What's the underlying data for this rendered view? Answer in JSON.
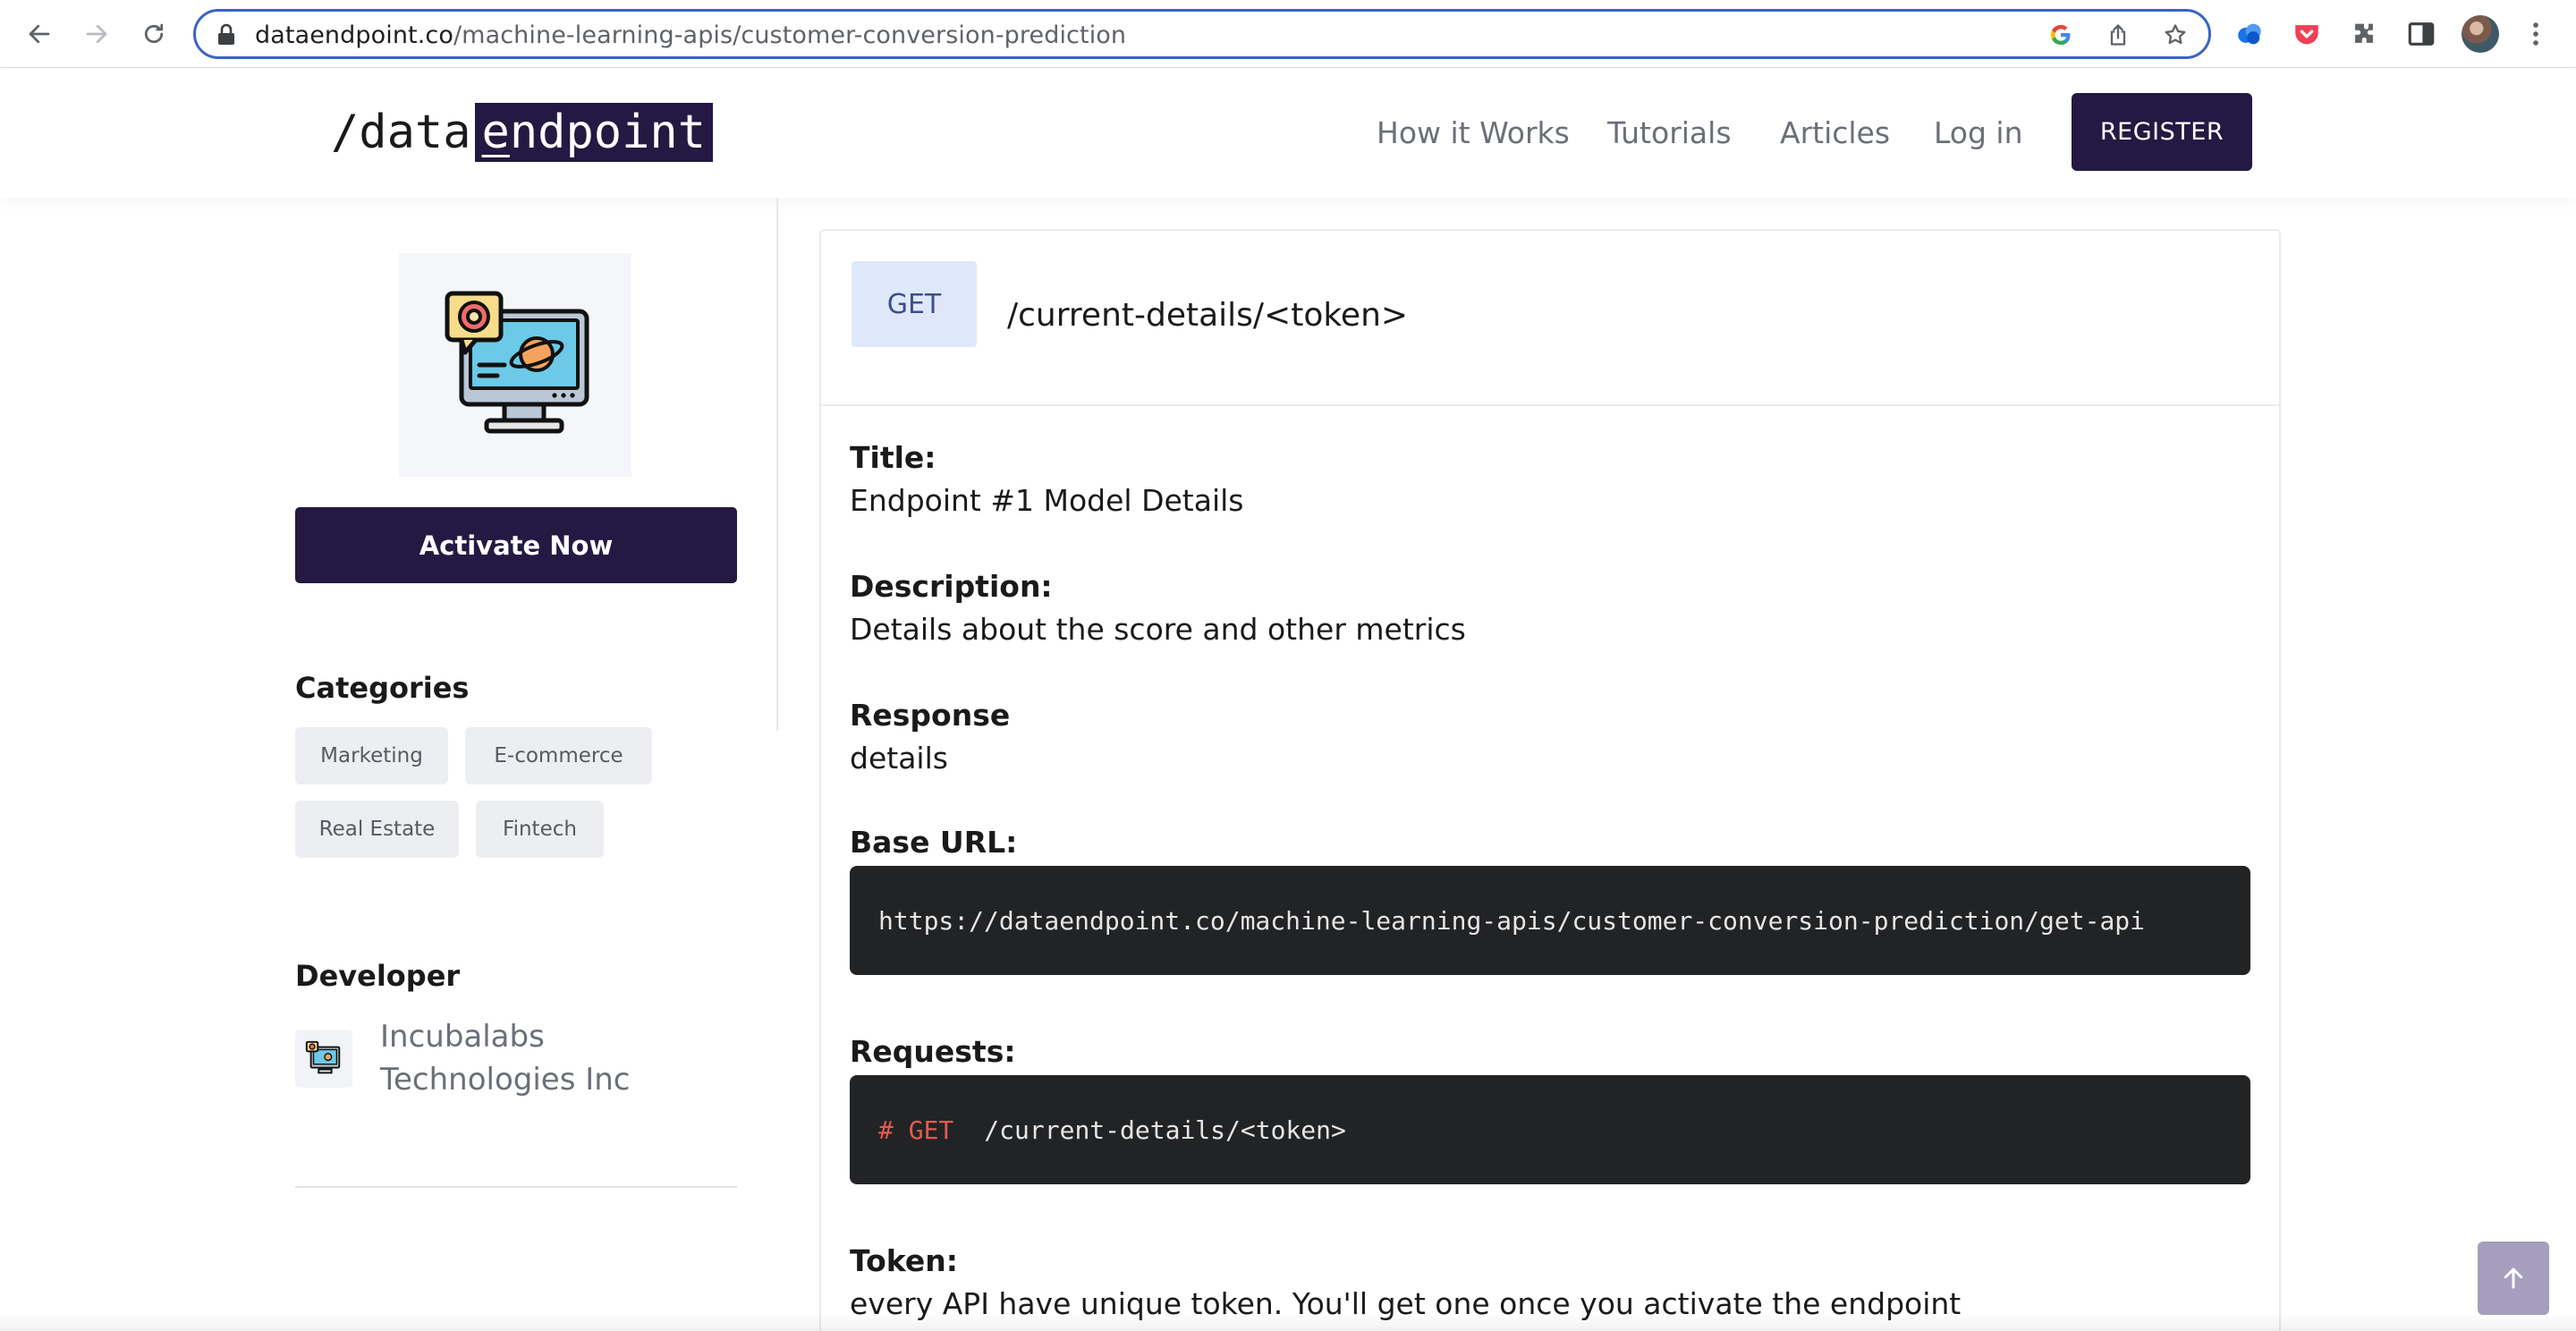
{
  "browser": {
    "url_host": "dataendpoint.co",
    "url_path": "/machine-learning-apis/customer-conversion-prediction"
  },
  "header": {
    "logo_prefix": "/data",
    "logo_boxed": "endpoint",
    "logo_boxed_underline": "e",
    "logo_boxed_rest": "ndpoint",
    "nav": [
      {
        "label": "How it Works"
      },
      {
        "label": "Tutorials"
      },
      {
        "label": "Articles"
      },
      {
        "label": "Log in"
      }
    ],
    "register_label": "REGISTER"
  },
  "sidebar": {
    "activate_label": "Activate Now",
    "categories_heading": "Categories",
    "categories": [
      "Marketing",
      "E-commerce",
      "Real Estate",
      "Fintech"
    ],
    "developer_heading": "Developer",
    "developer_name": "Incubalabs Technologies Inc"
  },
  "endpoint": {
    "method": "GET",
    "path": "/current-details/<token>",
    "title_label": "Title:",
    "title_value": "Endpoint #1 Model Details",
    "description_label": "Description:",
    "description_value": "Details about the score and other metrics",
    "response_label": "Response",
    "response_value": "details",
    "base_url_label": "Base URL:",
    "base_url_value": "https://dataendpoint.co/machine-learning-apis/customer-conversion-prediction/get-api",
    "requests_label": "Requests:",
    "request_keyword": "# GET",
    "request_path": "/current-details/<token>",
    "token_label": "Token:",
    "token_value": "every API have unique token. You'll get one once you activate the endpoint"
  },
  "colors": {
    "brand": "#231942",
    "method_badge_bg": "#dfe8fb",
    "code_bg": "#222325",
    "code_keyword": "#e25b4f"
  }
}
